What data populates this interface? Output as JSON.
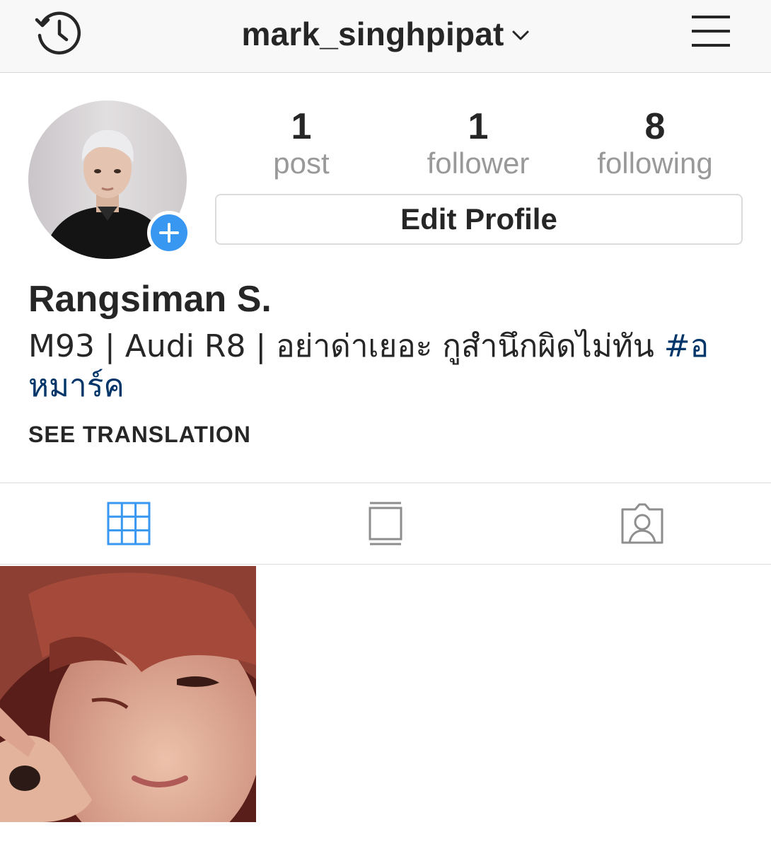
{
  "header": {
    "username": "mark_singhpipat",
    "history_icon": "history-icon",
    "dropdown_icon": "chevron-down-icon",
    "menu_icon": "hamburger-menu-icon"
  },
  "profile": {
    "avatar": "profile-photo",
    "add_story_icon": "plus-icon",
    "stats": [
      {
        "value": "1",
        "label": "post"
      },
      {
        "value": "1",
        "label": "follower"
      },
      {
        "value": "8",
        "label": "following"
      }
    ],
    "edit_profile_label": "Edit Profile",
    "full_name": "Rangsiman S.",
    "bio_text": "M93 | Audi R8 | อย่าด่าเยอะ กูสำนึกผิดไม่ทัน ",
    "bio_hashtag": "#อหมาร์ค",
    "see_translation_label": "SEE TRANSLATION"
  },
  "tabs": [
    {
      "icon": "grid-icon",
      "active": true
    },
    {
      "icon": "feed-list-icon",
      "active": false
    },
    {
      "icon": "tagged-user-icon",
      "active": false
    }
  ],
  "colors": {
    "accent": "#3897f0",
    "hashtag": "#003569",
    "muted": "#999999",
    "text": "#262626"
  }
}
